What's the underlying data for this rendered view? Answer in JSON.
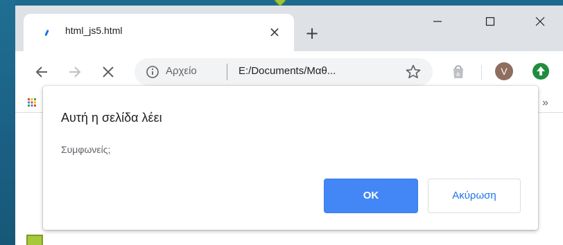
{
  "tab": {
    "title": "html_js5.html",
    "close_label": "×"
  },
  "new_tab_label": "+",
  "address_bar": {
    "scheme_label": "Αρχείο",
    "url": "E:/Documents/Μαθ..."
  },
  "profile": {
    "avatar_letter": "V"
  },
  "bookmarks": {
    "more_label": "»"
  },
  "dialog": {
    "title": "Αυτή η σελίδα λέει",
    "message": "Συμφωνείς;",
    "ok_label": "OK",
    "cancel_label": "Ακύρωση"
  },
  "colors": {
    "desktop": "#1c6a8f",
    "tab_strip": "#dee1e6",
    "ok_button": "#4287f5",
    "cancel_text": "#1a73e8",
    "avatar": "#8d6e5f",
    "update_badge": "#1e8e3e",
    "page_square": "#a6c83a"
  },
  "icons": {
    "favicon": "loading-favicon-icon",
    "back": "arrow-left-icon",
    "forward": "arrow-right-icon",
    "stop": "close-x-icon",
    "info": "info-circle-icon",
    "bookmark": "star-outline-icon",
    "extension": "shopping-bag-icon",
    "update": "arrow-up-circle-icon",
    "apps": "apps-grid-icon"
  }
}
